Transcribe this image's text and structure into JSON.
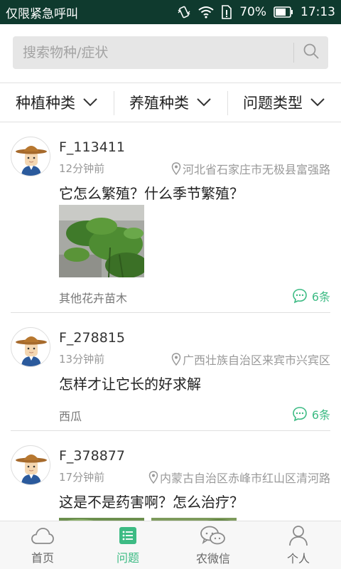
{
  "status_bar": {
    "carrier": "仅限紧急呼叫",
    "battery": "70%",
    "time": "17:13",
    "icons": [
      "vibrate-icon",
      "wifi-icon",
      "sim-icon",
      "battery-icon"
    ]
  },
  "search": {
    "placeholder": "搜索物种/症状"
  },
  "filters": [
    {
      "label": "种植种类"
    },
    {
      "label": "养殖种类"
    },
    {
      "label": "问题类型"
    }
  ],
  "posts": [
    {
      "username": "F_113411",
      "time": "12分钟前",
      "location": "河北省石家庄市无极县富强路",
      "question": "它怎么繁殖？什么季节繁殖？",
      "category": "其他花卉苗木",
      "comments": "6条"
    },
    {
      "username": "F_278815",
      "time": "13分钟前",
      "location": "广西壮族自治区来宾市兴宾区",
      "question": "怎样才让它长的好求解",
      "category": "西瓜",
      "comments": "6条"
    },
    {
      "username": "F_378877",
      "time": "17分钟前",
      "location": "内蒙古自治区赤峰市红山区清河路",
      "question": "这是不是药害啊？怎么治疗？"
    }
  ],
  "tabs": [
    {
      "label": "首页",
      "icon": "cloud-icon"
    },
    {
      "label": "问题",
      "icon": "list-icon"
    },
    {
      "label": "农微信",
      "icon": "chat-icon"
    },
    {
      "label": "个人",
      "icon": "person-icon"
    }
  ],
  "colors": {
    "accent": "#3dbb84",
    "status_bar": "#0f3a2e"
  }
}
